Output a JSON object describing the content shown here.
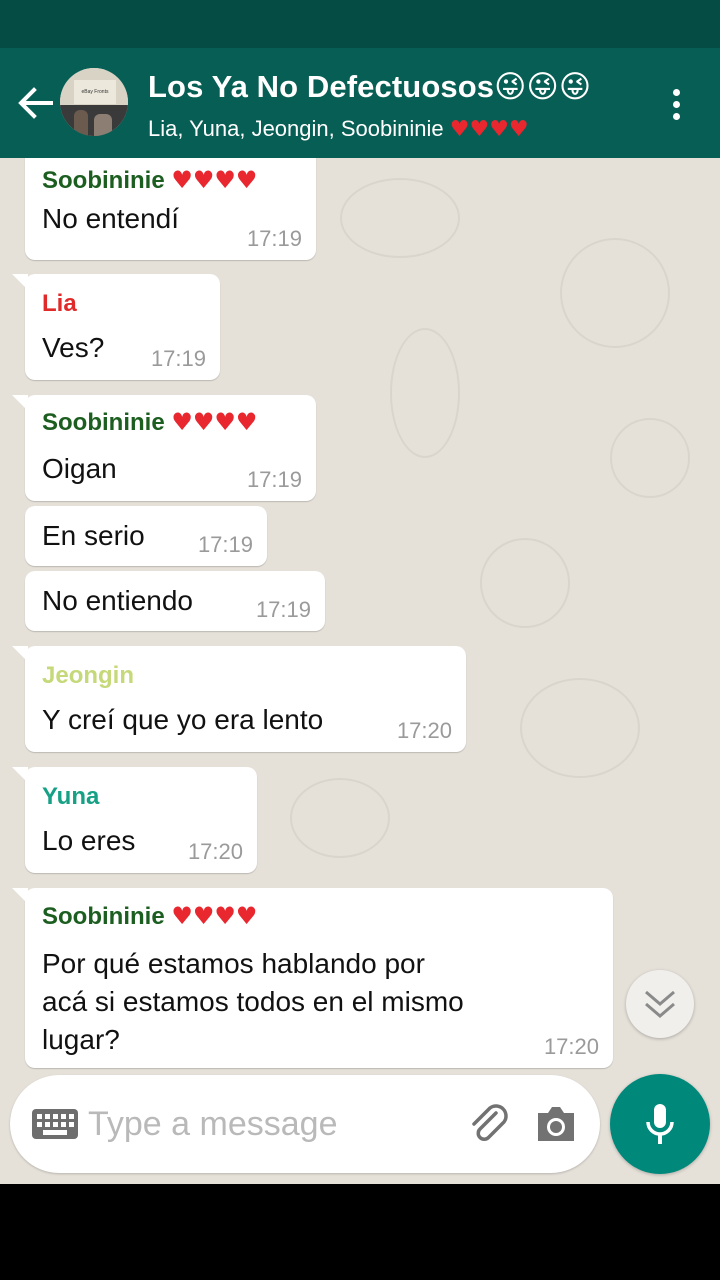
{
  "header": {
    "title": "Los Ya No Defectuosos",
    "title_emojis": "😜😜😜",
    "participants": "Lia, Yuna, Jeongin, Soobininie",
    "participants_hearts": "♥♥♥♥",
    "avatar_caption": "eBay Fronts"
  },
  "messages": [
    {
      "sender": "Soobininie",
      "hearts": "♥♥♥♥",
      "text": "No entendí",
      "time": "17:19",
      "sender_color": "#1c5e20"
    },
    {
      "sender": "Lia",
      "hearts": "",
      "text": "Ves?",
      "time": "17:19",
      "sender_color": "#e02a2a"
    },
    {
      "sender": "Soobininie",
      "hearts": "♥♥♥♥",
      "text": "Oigan",
      "time": "17:19",
      "sender_color": "#1c5e20"
    },
    {
      "sender": "",
      "text": "En serio",
      "time": "17:19"
    },
    {
      "sender": "",
      "text": "No entiendo",
      "time": "17:19"
    },
    {
      "sender": "Jeongin",
      "hearts": "",
      "text": "Y creí que yo era lento",
      "time": "17:20",
      "sender_color": "#c5d97a"
    },
    {
      "sender": "Yuna",
      "hearts": "",
      "text": "Lo eres",
      "time": "17:20",
      "sender_color": "#16a085"
    },
    {
      "sender": "Soobininie",
      "hearts": "♥♥♥♥",
      "text_lines": [
        "Por qué estamos hablando por",
        "acá si estamos todos en el mismo",
        "lugar?"
      ],
      "time": "17:20",
      "sender_color": "#1c5e20"
    }
  ],
  "composer": {
    "placeholder": "Type a message"
  },
  "icons": {
    "back": "arrow-left-icon",
    "menu": "more-vert-icon",
    "scroll": "chevron-double-down-icon",
    "keyboard": "keyboard-icon",
    "attach": "paperclip-icon",
    "camera": "camera-icon",
    "mic": "microphone-icon"
  },
  "colors": {
    "status_bar": "#054d44",
    "app_bar": "#075e54",
    "chat_bg": "#e5e1d9",
    "accent": "#00897b",
    "heart": "#e8272f"
  }
}
